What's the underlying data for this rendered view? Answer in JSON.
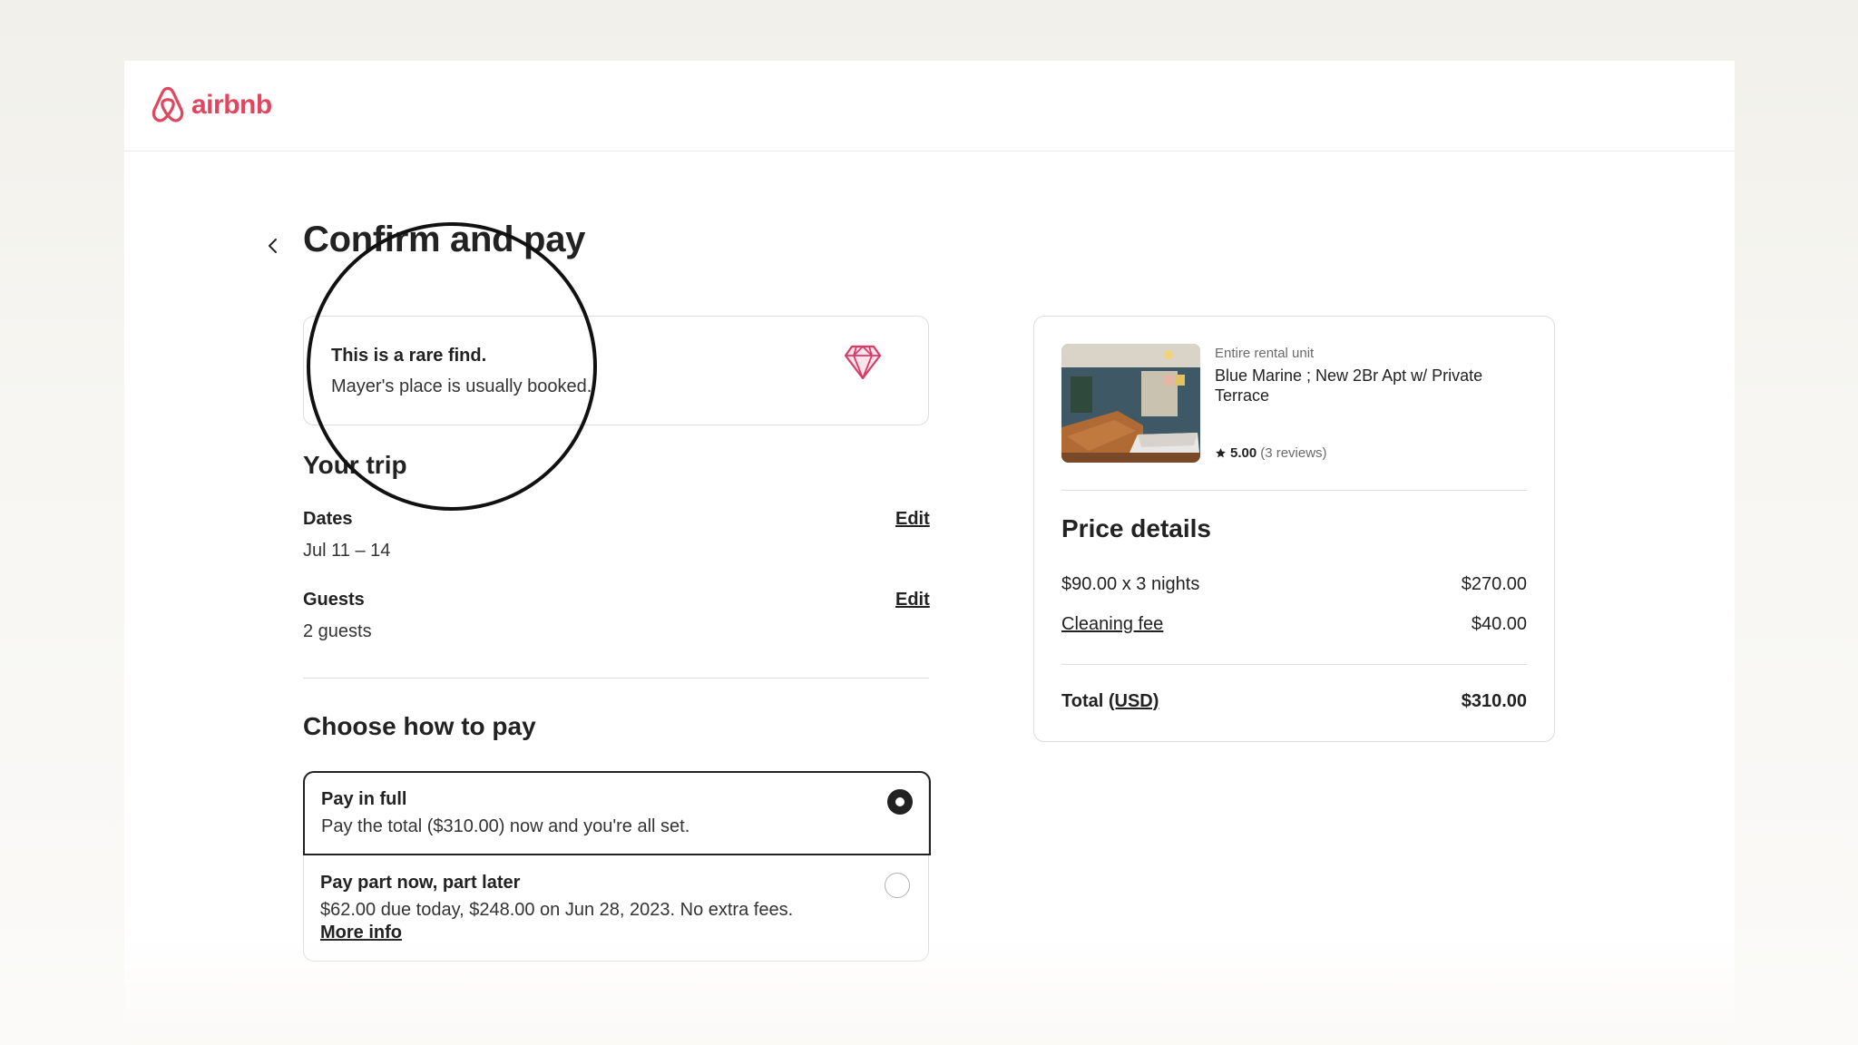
{
  "brand": {
    "name": "airbnb",
    "color": "#e0465e"
  },
  "page": {
    "title": "Confirm and pay"
  },
  "rare": {
    "title": "This is a rare find.",
    "subtitle": "Mayer's place is usually booked.",
    "icon": "diamond-icon"
  },
  "trip": {
    "title": "Your trip",
    "dates": {
      "label": "Dates",
      "value": "Jul 11 – 14",
      "edit": "Edit"
    },
    "guests": {
      "label": "Guests",
      "value": "2 guests",
      "edit": "Edit"
    }
  },
  "payment": {
    "title": "Choose how to pay",
    "options": [
      {
        "title": "Pay in full",
        "desc": "Pay the total ($310.00) now and you're all set.",
        "selected": true
      },
      {
        "title": "Pay part now, part later",
        "desc": "$62.00 due today, $248.00 on Jun 28, 2023. No extra fees.",
        "link": "More info",
        "selected": false
      }
    ]
  },
  "listing": {
    "type": "Entire rental unit",
    "name": "Blue Marine ; New 2Br Apt w/ Private Terrace",
    "rating": "5.00",
    "reviews": "(3 reviews)"
  },
  "price": {
    "title": "Price details",
    "lines": [
      {
        "label": "$90.00 x 3 nights",
        "value": "$270.00"
      },
      {
        "label": "Cleaning fee",
        "value": "$40.00"
      }
    ],
    "total_label": "Total",
    "total_currency": "(USD)",
    "total_value": "$310.00"
  }
}
